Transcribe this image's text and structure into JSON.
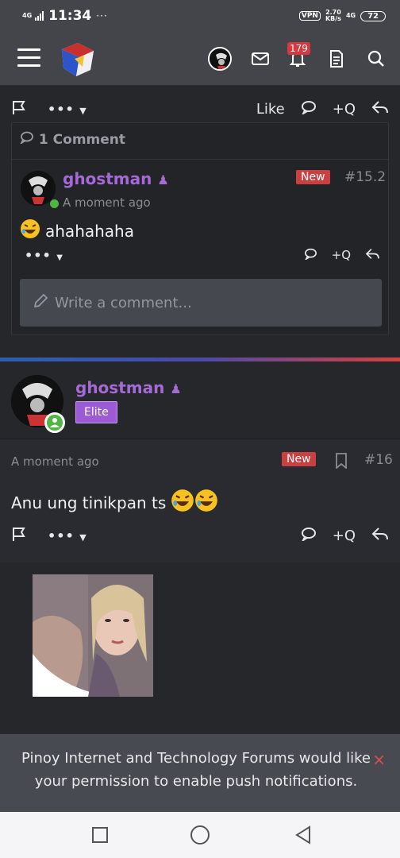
{
  "status_bar": {
    "network": "4G",
    "time": "11:34",
    "more": "···",
    "vpn": "VPN",
    "speed_value": "2.70",
    "speed_unit": "KB/s",
    "network_right": "4G",
    "battery": "72"
  },
  "app_bar": {
    "notification_count": "179"
  },
  "top_post": {
    "action_bar": {
      "more_label": "•••",
      "like_label": "Like",
      "quote_label": "+Q"
    },
    "comments": {
      "header": "1 Comment",
      "comment": {
        "username": "ghostman",
        "timestamp": "A moment ago",
        "badge": "New",
        "post_number": "#15.2",
        "text": "ahahahaha",
        "more_label": "•••",
        "quote_label": "+Q"
      },
      "input_placeholder": "Write a comment..."
    }
  },
  "post16": {
    "username": "ghostman",
    "rank": "Elite",
    "timestamp": "A moment ago",
    "badge": "New",
    "post_number": "#16",
    "text": "Anu ung tinikpan ts",
    "more_label": "•••",
    "quote_label": "+Q"
  },
  "push_banner": {
    "text": "Pinoy Internet and Technology Forums would like your permission to enable push notifications.",
    "close": "×"
  },
  "colors": {
    "username": "#a56ad6",
    "new_badge": "#c94040",
    "elite_badge": "#9d5ad6",
    "online": "#4fb543"
  }
}
